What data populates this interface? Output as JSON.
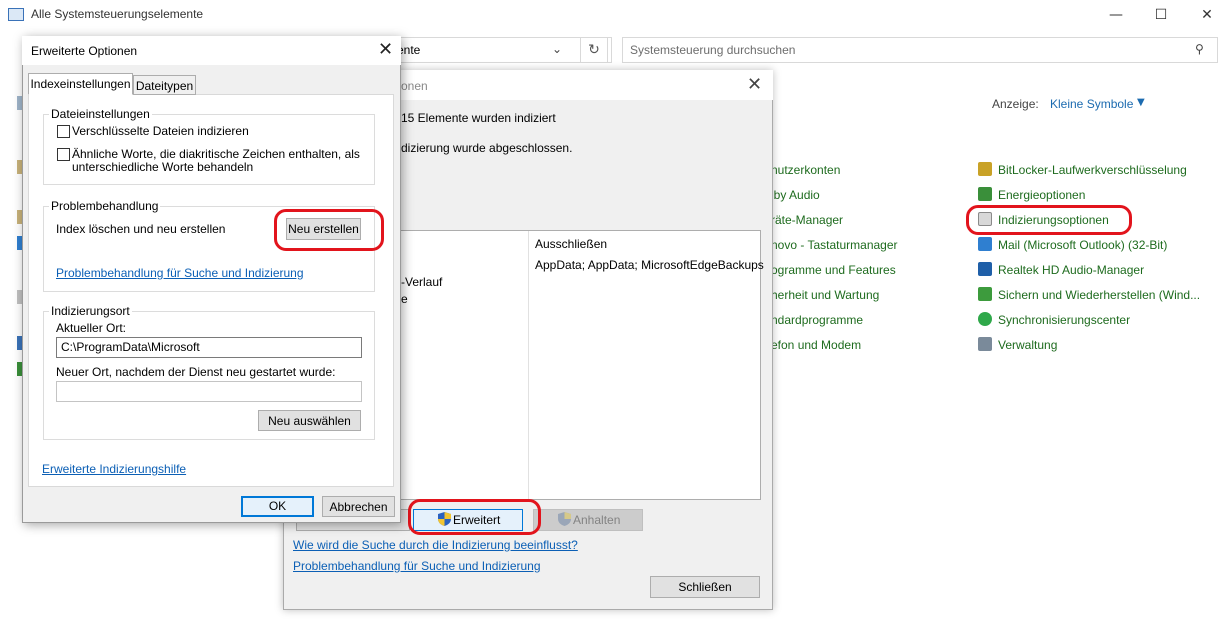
{
  "cp": {
    "window_title": "Alle Systemsteuerungselemente",
    "address_text": "ente",
    "search_placeholder": "Systemsteuerung durchsuchen",
    "view_label": "Anzeige:",
    "view_value": "Kleine Symbole",
    "col1": [
      "nutzerkonten",
      "lby Audio",
      "räte-Manager",
      "novo - Tastaturmanager",
      "ogramme und Features",
      "herheit und Wartung",
      "ndardprogramme",
      "efon und Modem"
    ],
    "col2": [
      {
        "label": "BitLocker-Laufwerkverschlüsselung",
        "icon": "bitlocker-icon",
        "color": "#c9a227"
      },
      {
        "label": "Energieoptionen",
        "icon": "power-options-icon",
        "color": "#3a8f3a"
      },
      {
        "label": "Indizierungsoptionen",
        "icon": "indexing-options-icon",
        "color": "#8a8a8a"
      },
      {
        "label": "Mail (Microsoft Outlook) (32-Bit)",
        "icon": "mail-icon",
        "color": "#2f7fd0"
      },
      {
        "label": "Realtek HD Audio-Manager",
        "icon": "realtek-audio-icon",
        "color": "#1f5fa8"
      },
      {
        "label": "Sichern und Wiederherstellen (Wind...",
        "icon": "backup-icon",
        "color": "#3d9b3d"
      },
      {
        "label": "Synchronisierungscenter",
        "icon": "sync-center-icon",
        "color": "#2fa84a"
      },
      {
        "label": "Verwaltung",
        "icon": "admin-tools-icon",
        "color": "#7a8a9a"
      }
    ]
  },
  "idx": {
    "title_partial": "onen",
    "count_text": "15 Elemente wurden indiziert",
    "status_text": "dizierung wurde abgeschlossen.",
    "list_left": [
      "-Verlauf",
      "e"
    ],
    "exclude_header": "Ausschließen",
    "exclude_values": "AppData; AppData; MicrosoftEdgeBackups",
    "btn_advanced": "Erweitert",
    "btn_pause": "Anhalten",
    "link_search": "Wie wird die Suche durch die Indizierung beeinflusst?",
    "link_troubleshoot": "Problembehandlung für Suche und Indizierung",
    "btn_close": "Schließen"
  },
  "adv": {
    "title": "Erweiterte Optionen",
    "tab_index": "Indexeinstellungen",
    "tab_filetypes": "Dateitypen",
    "file_settings_label": "Dateieinstellungen",
    "chk_encrypted": "Verschlüsselte Dateien indizieren",
    "chk_diacritics_line1": "Ähnliche Worte, die diakritische Zeichen enthalten, als",
    "chk_diacritics_line2": "unterschiedliche Worte behandeln",
    "troubleshoot_label": "Problembehandlung",
    "rebuild_text": "Index löschen und neu erstellen",
    "btn_rebuild": "Neu erstellen",
    "troubleshoot_link": "Problembehandlung für Suche und Indizierung",
    "location_label": "Indizierungsort",
    "current_location_label": "Aktueller Ort:",
    "current_location_value": "C:\\ProgramData\\Microsoft",
    "new_location_label": "Neuer Ort, nachdem der Dienst neu gestartet wurde:",
    "new_location_value": "",
    "btn_select_new": "Neu auswählen",
    "help_link": "Erweiterte Indizierungshilfe",
    "btn_ok": "OK",
    "btn_cancel": "Abbrechen"
  },
  "colors": {
    "link": "#0b5fb5",
    "cp_item": "#1e6b1e",
    "highlight": "#e2141c",
    "focus_border": "#0078d7"
  }
}
